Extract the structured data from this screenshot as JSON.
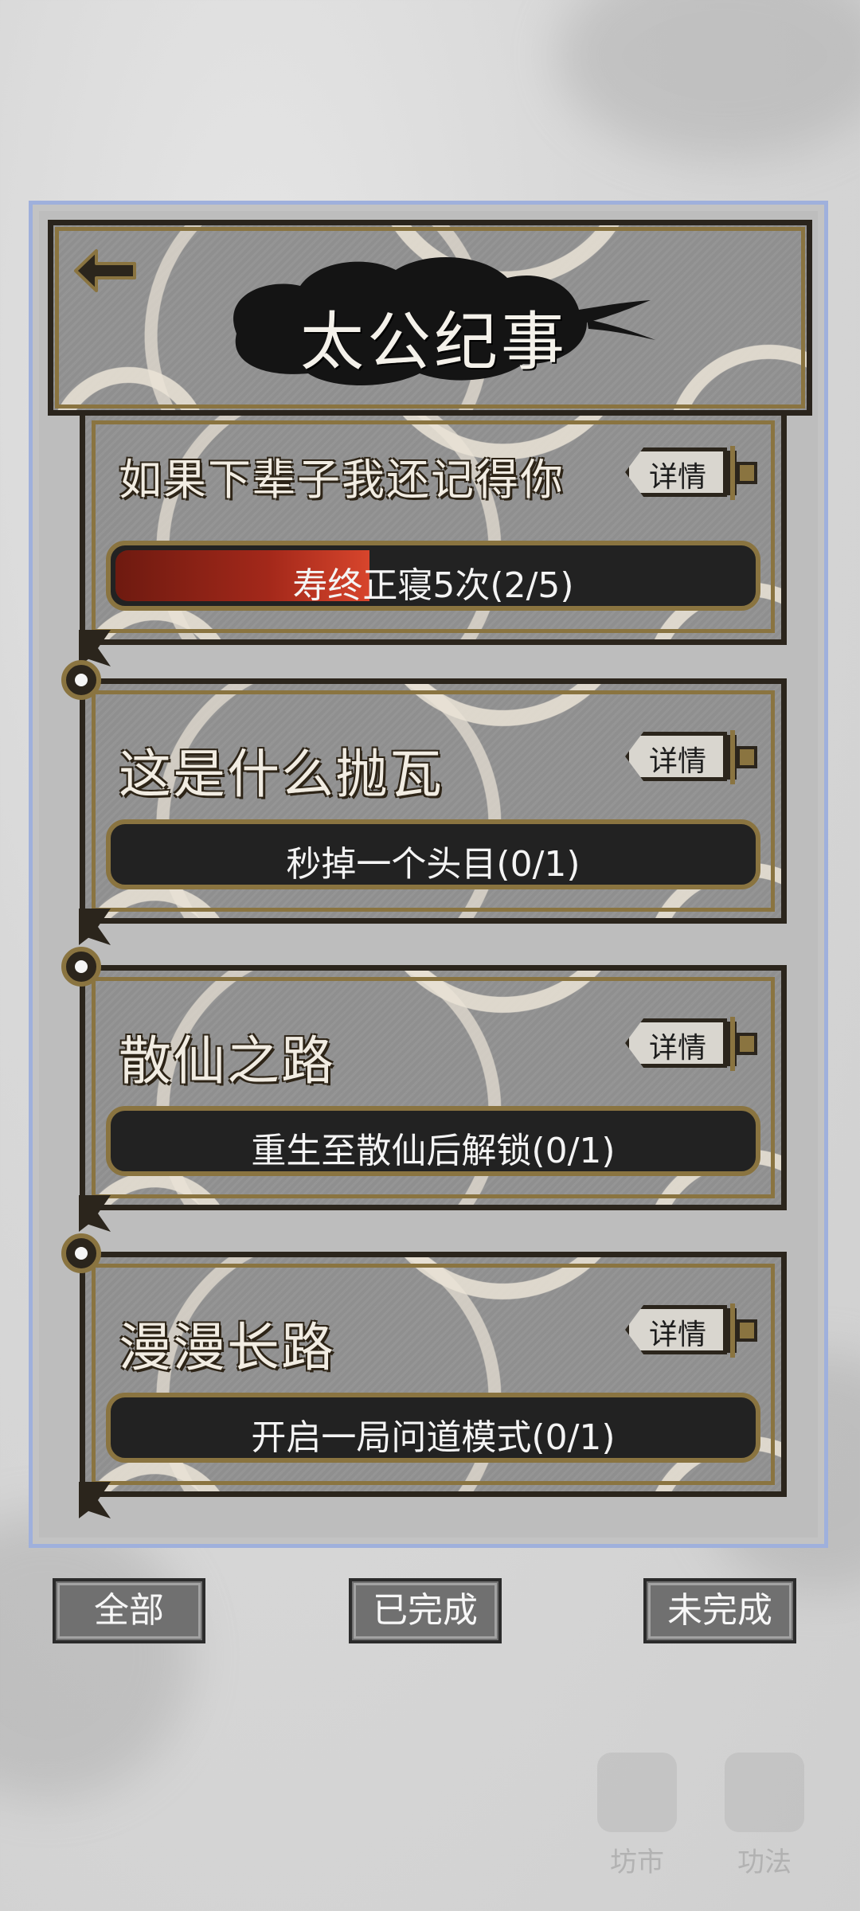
{
  "header": {
    "title": "太公纪事"
  },
  "cards": [
    {
      "title": "如果下辈子我还记得你",
      "detail_label": "详情",
      "progress_text": "寿终正寝5次(2/5)",
      "progress": 0.4
    },
    {
      "title": "这是什么抛瓦",
      "detail_label": "详情",
      "progress_text": "秒掉一个头目(0/1)",
      "progress": 0
    },
    {
      "title": "散仙之路",
      "detail_label": "详情",
      "progress_text": "重生至散仙后解锁(0/1)",
      "progress": 0
    },
    {
      "title": "漫漫长路",
      "detail_label": "详情",
      "progress_text": "开启一局问道模式(0/1)",
      "progress": 0
    }
  ],
  "filters": {
    "all": "全部",
    "completed": "已完成",
    "incomplete": "未完成"
  },
  "background_nav": {
    "market": "坊市",
    "skills": "功法"
  },
  "colors": {
    "panel_border": "#9fb0dc",
    "card_gold": "#8a7440",
    "progress_red": "#c8361f"
  }
}
